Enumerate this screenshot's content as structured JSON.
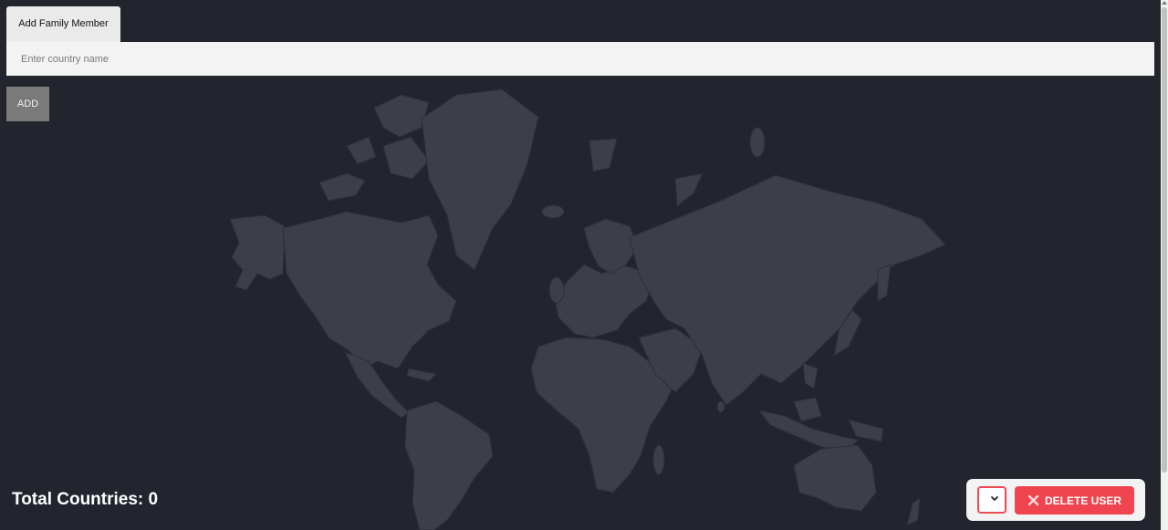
{
  "tabs": [
    {
      "label": "Add Family Member"
    }
  ],
  "country_input": {
    "value": "",
    "placeholder": "Enter country name"
  },
  "add_button": {
    "label": "ADD"
  },
  "stats": {
    "total_countries_label": "Total Countries: 0"
  },
  "user_controls": {
    "selected_user": "",
    "delete_label": "DELETE USER",
    "delete_icon": "close-icon"
  },
  "colors": {
    "background": "#22252e",
    "land": "#3c3f49",
    "delete_button": "#f0454f",
    "add_button": "#7a7a7a"
  }
}
